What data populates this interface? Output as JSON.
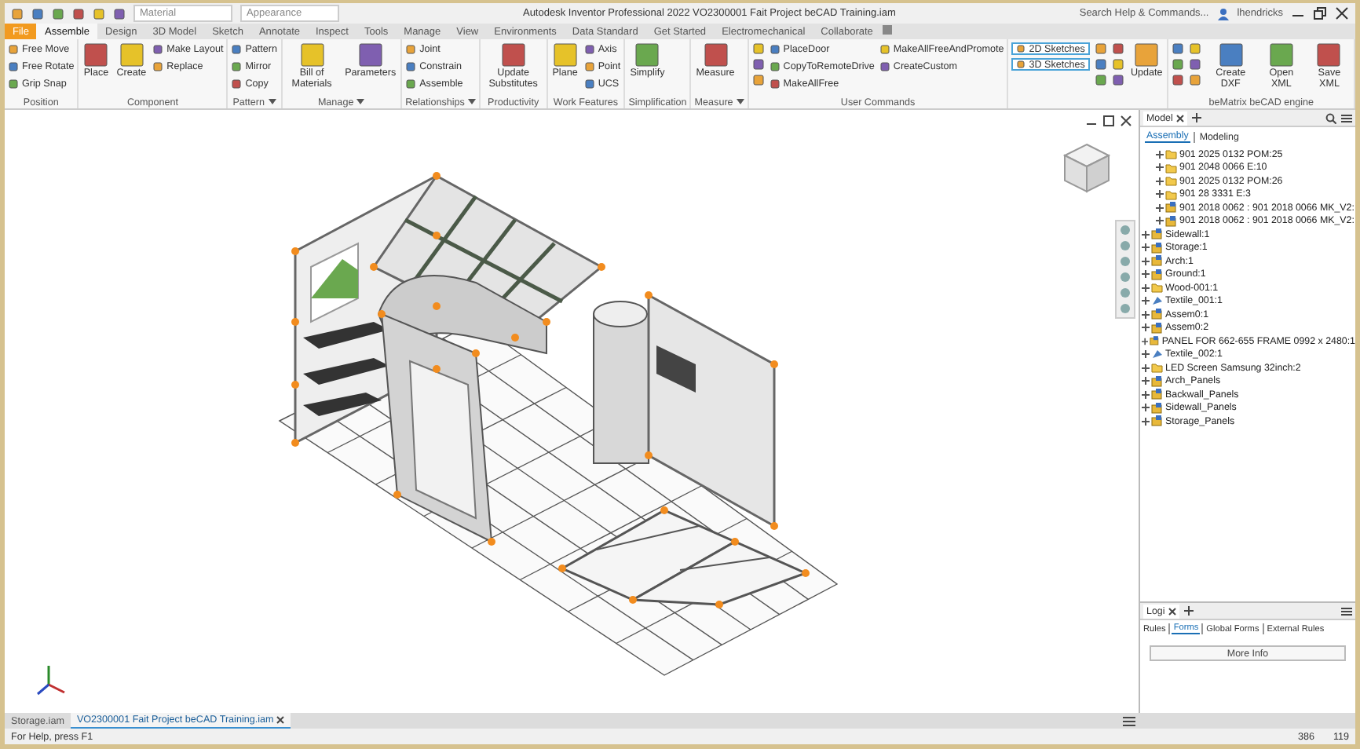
{
  "title_bar": {
    "material": "Material",
    "appearance": "Appearance",
    "title": "Autodesk Inventor Professional 2022    VO2300001 Fait Project beCAD Training.iam",
    "search_placeholder": "Search Help & Commands...",
    "user": "lhendricks"
  },
  "ribbon_tabs": [
    {
      "label": "File",
      "kind": "application"
    },
    {
      "label": "Assemble",
      "kind": "tab",
      "selected": true
    },
    {
      "label": "Design",
      "kind": "tab",
      "selected": false
    },
    {
      "label": "3D Model",
      "kind": "tab",
      "selected": false
    },
    {
      "label": "Sketch",
      "kind": "tab",
      "selected": false
    },
    {
      "label": "Annotate",
      "kind": "tab",
      "selected": false
    },
    {
      "label": "Inspect",
      "kind": "tab",
      "selected": false
    },
    {
      "label": "Tools",
      "kind": "tab",
      "selected": false
    },
    {
      "label": "Manage",
      "kind": "tab",
      "selected": false
    },
    {
      "label": "View",
      "kind": "tab",
      "selected": false
    },
    {
      "label": "Environments",
      "kind": "tab",
      "selected": false
    },
    {
      "label": "Data Standard",
      "kind": "tab",
      "selected": false
    },
    {
      "label": "Get Started",
      "kind": "tab",
      "selected": false
    },
    {
      "label": "Electromechanical",
      "kind": "tab",
      "selected": false
    },
    {
      "label": "Collaborate",
      "kind": "tab",
      "selected": false
    }
  ],
  "ribbon_groups": [
    {
      "title": "Position",
      "menu": false,
      "columns": [
        {
          "kind": "small",
          "items": [
            "Free Move",
            "Free Rotate",
            "Grip Snap"
          ]
        }
      ]
    },
    {
      "title": "Component",
      "menu": false,
      "columns": [
        {
          "kind": "large",
          "items": [
            "Place"
          ]
        },
        {
          "kind": "large",
          "items": [
            "Create"
          ]
        },
        {
          "kind": "small",
          "items": [
            "Make Layout",
            "Replace"
          ]
        }
      ]
    },
    {
      "title": "Pattern",
      "menu": true,
      "columns": [
        {
          "kind": "small",
          "items": [
            "Pattern",
            "Mirror",
            "Copy"
          ]
        }
      ]
    },
    {
      "title": "Manage",
      "menu": true,
      "columns": [
        {
          "kind": "large",
          "items": [
            "Bill of Materials"
          ]
        },
        {
          "kind": "large",
          "items": [
            "Parameters"
          ]
        }
      ]
    },
    {
      "title": "Relationships",
      "menu": true,
      "columns": [
        {
          "kind": "small",
          "items": [
            "Joint",
            "Constrain",
            "Assemble"
          ]
        }
      ]
    },
    {
      "title": "Productivity",
      "menu": false,
      "columns": [
        {
          "kind": "large",
          "items": [
            "Update Substitutes"
          ]
        }
      ]
    },
    {
      "title": "Work Features",
      "menu": false,
      "columns": [
        {
          "kind": "large",
          "items": [
            "Plane"
          ]
        },
        {
          "kind": "small",
          "items": [
            "Axis",
            "Point",
            "UCS"
          ]
        }
      ]
    },
    {
      "title": "Simplification",
      "menu": false,
      "columns": [
        {
          "kind": "large",
          "items": [
            "Simplify"
          ]
        }
      ]
    },
    {
      "title": "Measure",
      "menu": true,
      "columns": [
        {
          "kind": "large",
          "items": [
            "Measure"
          ]
        }
      ]
    },
    {
      "title": "User Commands",
      "menu": false,
      "columns": [
        {
          "kind": "icons"
        },
        {
          "kind": "small",
          "items": [
            "PlaceDoor",
            "CopyToRemoteDrive",
            "MakeAllFree"
          ]
        },
        {
          "kind": "small",
          "items": [
            "MakeAllFreeAndPromote",
            "CreateCustom"
          ]
        }
      ]
    },
    {
      "menu": false,
      "columns": [
        {
          "kind": "boxed",
          "items": [
            "2D Sketches",
            "3D Sketches"
          ]
        },
        {
          "kind": "icons"
        },
        {
          "kind": "icons"
        },
        {
          "kind": "large",
          "items": [
            "Update"
          ]
        }
      ]
    },
    {
      "title": "beMatrix beCAD engine",
      "menu": false,
      "columns": [
        {
          "kind": "icons"
        },
        {
          "kind": "icons"
        },
        {
          "kind": "large",
          "items": [
            "Create DXF"
          ]
        },
        {
          "kind": "large",
          "items": [
            "Open XML"
          ]
        },
        {
          "kind": "large",
          "items": [
            "Save XML"
          ]
        }
      ]
    }
  ],
  "model_browser": {
    "title": "Model",
    "tabs": [
      {
        "label": "Assembly",
        "selected": true
      },
      {
        "label": "Modeling",
        "selected": false
      }
    ],
    "nested_items": [
      {
        "label": "901 2025 0132 POM:25",
        "kind": "folder",
        "expanded": false
      },
      {
        "label": "901 2048 0066 E:10",
        "kind": "folder",
        "expanded": false
      },
      {
        "label": "901 2025 0132 POM:26",
        "kind": "folder",
        "expanded": false
      },
      {
        "label": "901 28 3331 E:3",
        "kind": "folder",
        "expanded": false
      },
      {
        "label": "901 2018 0062 : 901 2018 0066 MK_V2:",
        "kind": "assembly",
        "expanded": false
      },
      {
        "label": "901 2018 0062 : 901 2018 0066 MK_V2:",
        "kind": "assembly",
        "expanded": false
      }
    ],
    "items": [
      {
        "label": "Sidewall:1",
        "kind": "assembly",
        "expanded": false
      },
      {
        "label": "Storage:1",
        "kind": "assembly",
        "expanded": false
      },
      {
        "label": "Arch:1",
        "kind": "assembly",
        "expanded": false
      },
      {
        "label": "Ground:1",
        "kind": "assembly",
        "expanded": false
      },
      {
        "label": "Wood-001:1",
        "kind": "folder",
        "expanded": false
      },
      {
        "label": "Textile_001:1",
        "kind": "textile",
        "expanded": false
      },
      {
        "label": "Assem0:1",
        "kind": "assembly",
        "expanded": false
      },
      {
        "label": "Assem0:2",
        "kind": "assembly",
        "expanded": false
      },
      {
        "label": "PANEL FOR 662-655 FRAME 0992 x 2480:1",
        "kind": "assembly",
        "expanded": false
      },
      {
        "label": "Textile_002:1",
        "kind": "textile",
        "expanded": false
      },
      {
        "label": "LED Screen Samsung 32inch:2",
        "kind": "folder",
        "expanded": false
      },
      {
        "label": "Arch_Panels",
        "kind": "assembly",
        "expanded": false
      },
      {
        "label": "Backwall_Panels",
        "kind": "assembly",
        "expanded": false
      },
      {
        "label": "Sidewall_Panels",
        "kind": "assembly",
        "expanded": false
      },
      {
        "label": "Storage_Panels",
        "kind": "assembly",
        "expanded": false
      }
    ]
  },
  "logic_panel": {
    "title": "Logi",
    "tabs": [
      {
        "label": "Rules",
        "selected": false
      },
      {
        "label": "Forms",
        "selected": true
      },
      {
        "label": "Global Forms",
        "selected": false
      },
      {
        "label": "External Rules",
        "selected": false
      }
    ],
    "button": "More Info"
  },
  "document_tabs": [
    {
      "label": "Storage.iam",
      "selected": false
    },
    {
      "label": "VO2300001 Fait Project beCAD Training.iam",
      "selected": true
    }
  ],
  "status_bar": {
    "help": "For Help, press F1",
    "readouts": [
      "386",
      "119"
    ]
  }
}
